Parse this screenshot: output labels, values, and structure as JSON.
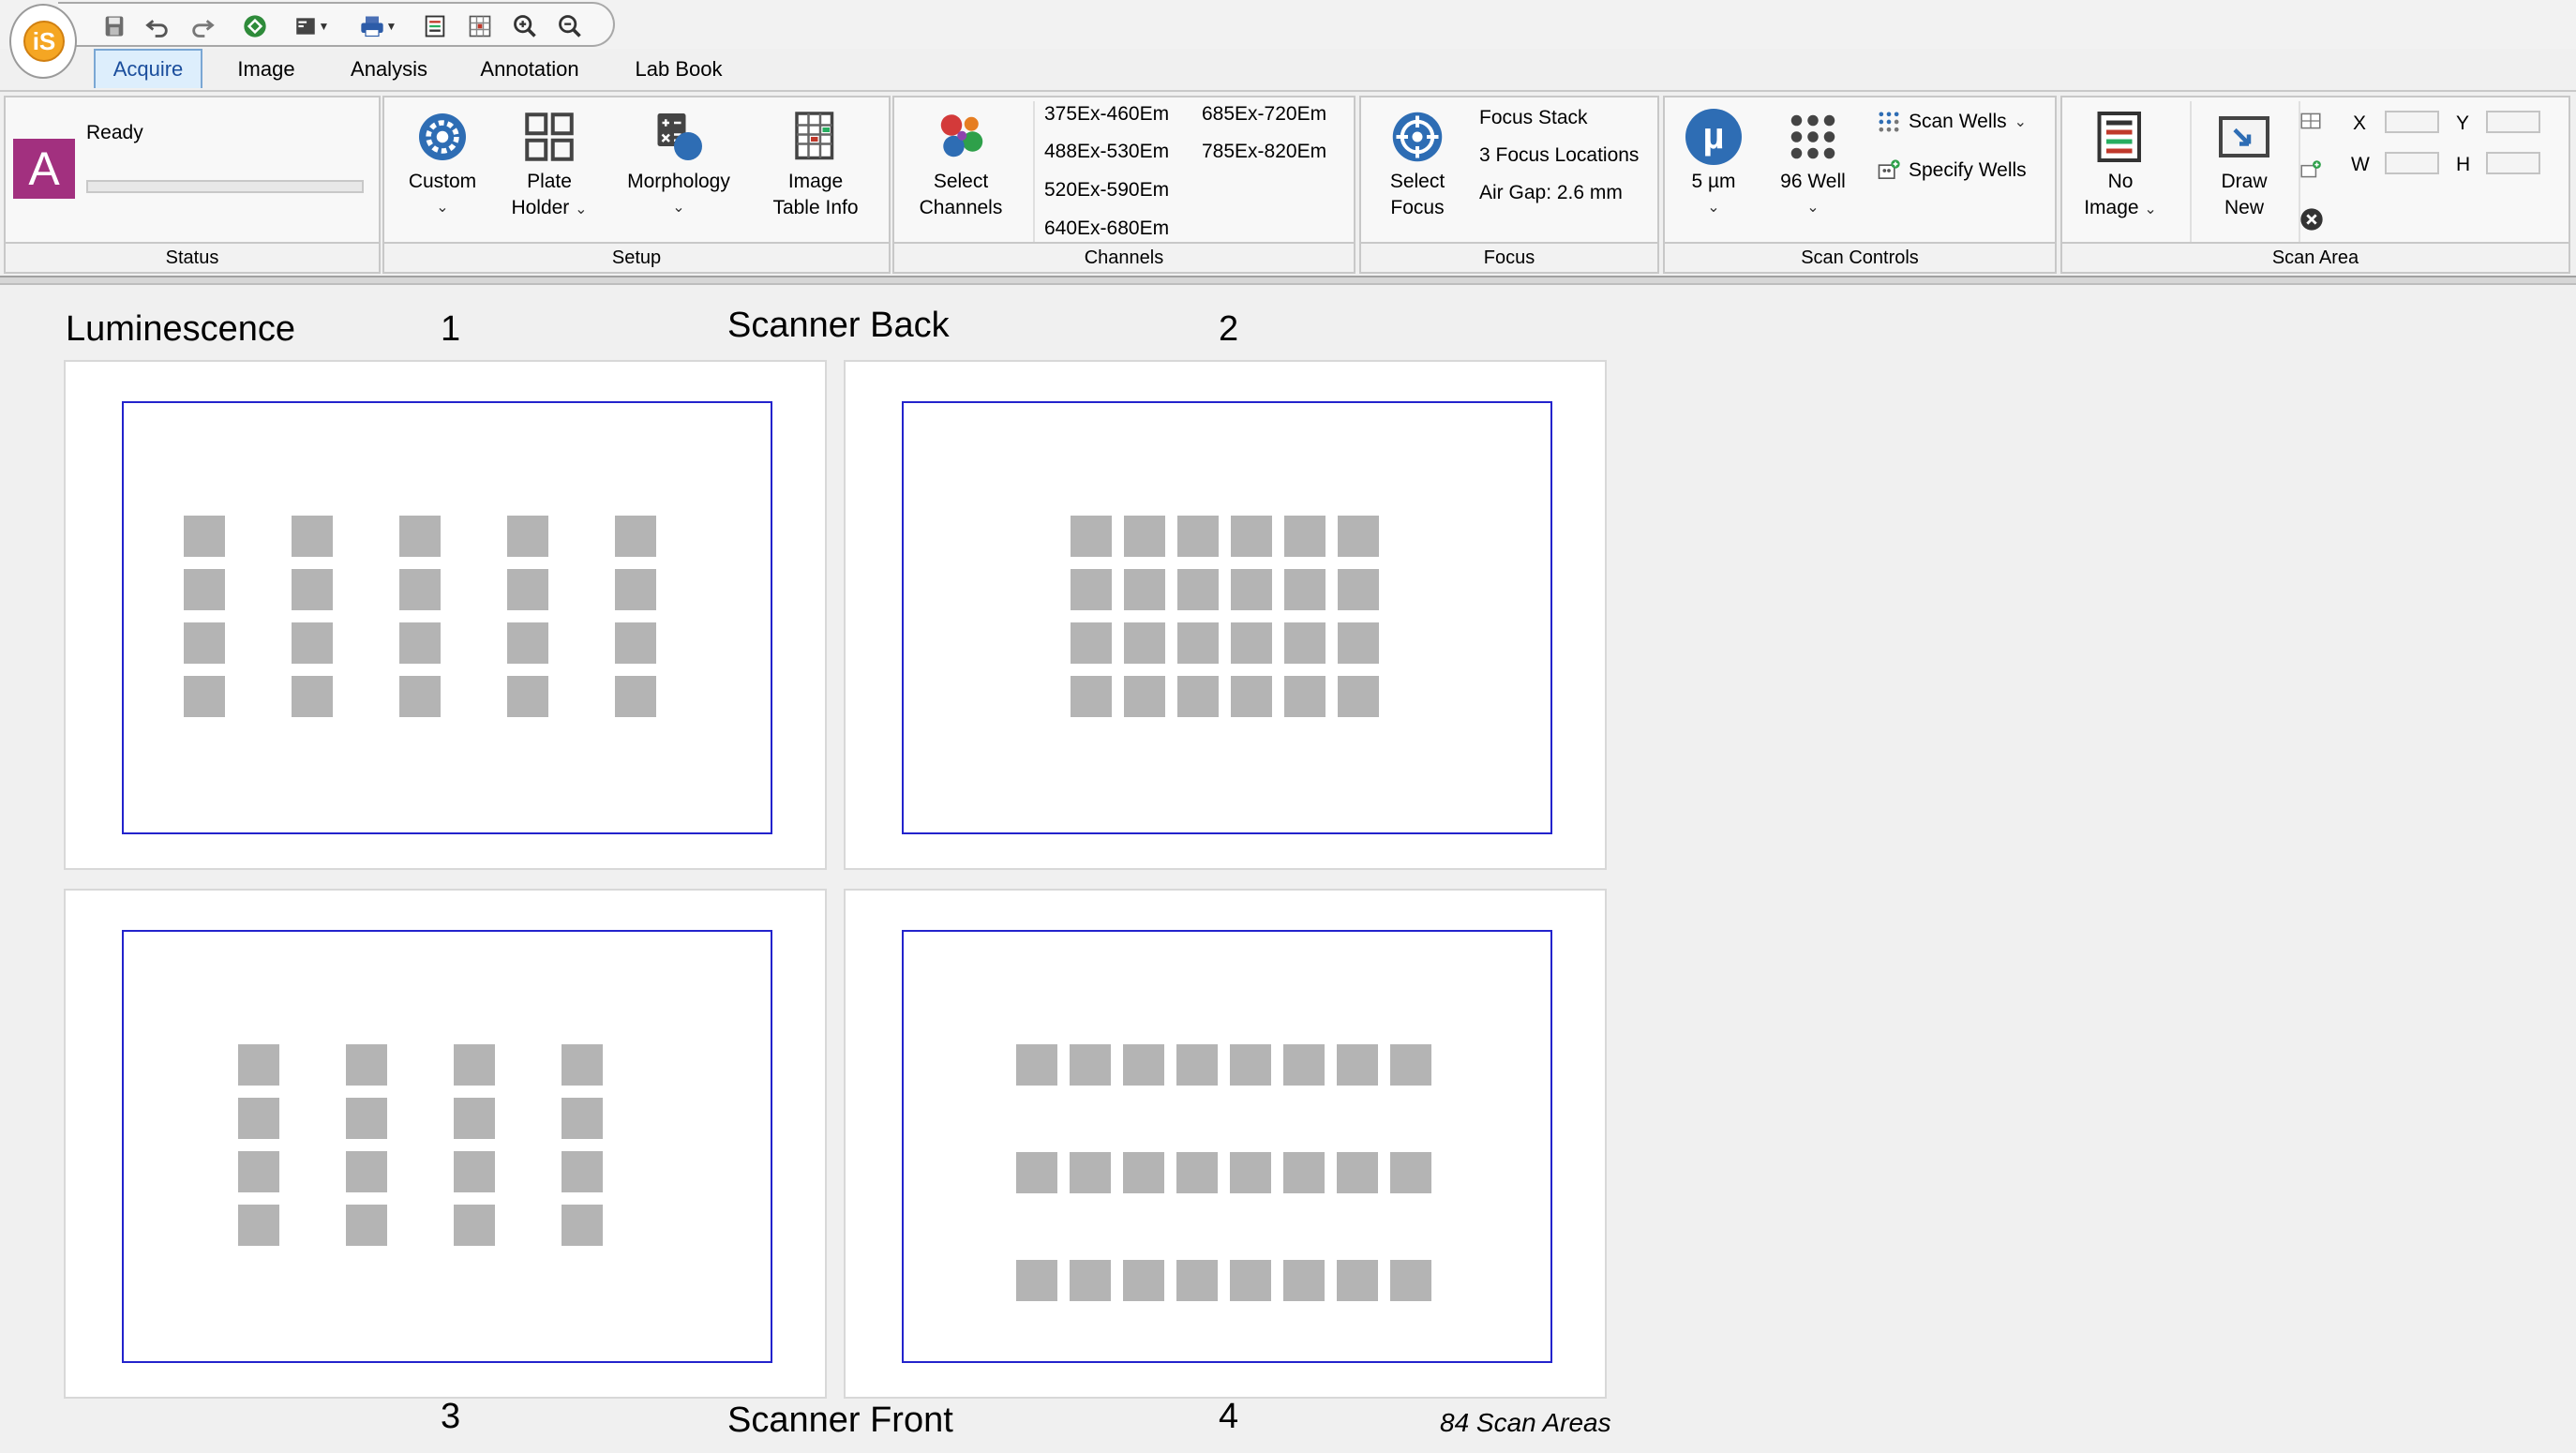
{
  "app": {
    "logo_text": "iS"
  },
  "quick_access": [
    "save-icon",
    "undo-icon",
    "redo-icon",
    "run-icon",
    "view-menu-icon",
    "print-icon",
    "report-icon",
    "grid-report-icon",
    "zoom-in-icon",
    "zoom-out-icon"
  ],
  "tabs": [
    {
      "label": "Acquire",
      "active": true
    },
    {
      "label": "Image",
      "active": false
    },
    {
      "label": "Analysis",
      "active": false
    },
    {
      "label": "Annotation",
      "active": false
    },
    {
      "label": "Lab Book",
      "active": false
    }
  ],
  "ribbon": {
    "status": {
      "badge": "A",
      "badge_color": "#a2307f",
      "state": "Ready",
      "progress": 0,
      "footer": "Status"
    },
    "setup": {
      "custom": "Custom",
      "plate_holder_1": "Plate",
      "plate_holder_2": "Holder",
      "morphology": "Morphology",
      "image_table_1": "Image",
      "image_table_2": "Table Info",
      "footer": "Setup"
    },
    "channels": {
      "select_1": "Select",
      "select_2": "Channels",
      "list_a": [
        "375Ex-460Em",
        "488Ex-530Em",
        "520Ex-590Em",
        "640Ex-680Em"
      ],
      "list_b": [
        "685Ex-720Em",
        "785Ex-820Em"
      ],
      "footer": "Channels"
    },
    "focus": {
      "select_1": "Select",
      "select_2": "Focus",
      "mode": "Focus Stack",
      "locations": "3 Focus Locations",
      "air_gap": "Air Gap: 2.6 mm",
      "footer": "Focus"
    },
    "scan_controls": {
      "resolution": "5 µm",
      "resolution_icon": "µ",
      "plate_type": "96 Well",
      "scan_wells": "Scan Wells",
      "specify_wells": "Specify Wells",
      "footer": "Scan Controls"
    },
    "scan_area": {
      "no_image_1": "No",
      "no_image_2": "Image",
      "draw_new_1": "Draw",
      "draw_new_2": "New",
      "x_label": "X",
      "y_label": "Y",
      "w_label": "W",
      "h_label": "H",
      "x_value": "",
      "y_value": "",
      "w_value": "",
      "h_value": "",
      "footer": "Scan Area"
    }
  },
  "canvas": {
    "mode_label": "Luminescence",
    "back_label": "Scanner Back",
    "front_label": "Scanner Front",
    "plate_numbers": [
      "1",
      "2",
      "3",
      "4"
    ],
    "scan_count": "84 Scan Areas",
    "well_color": "#b4b4b4",
    "frame_color": "#2323cc"
  }
}
